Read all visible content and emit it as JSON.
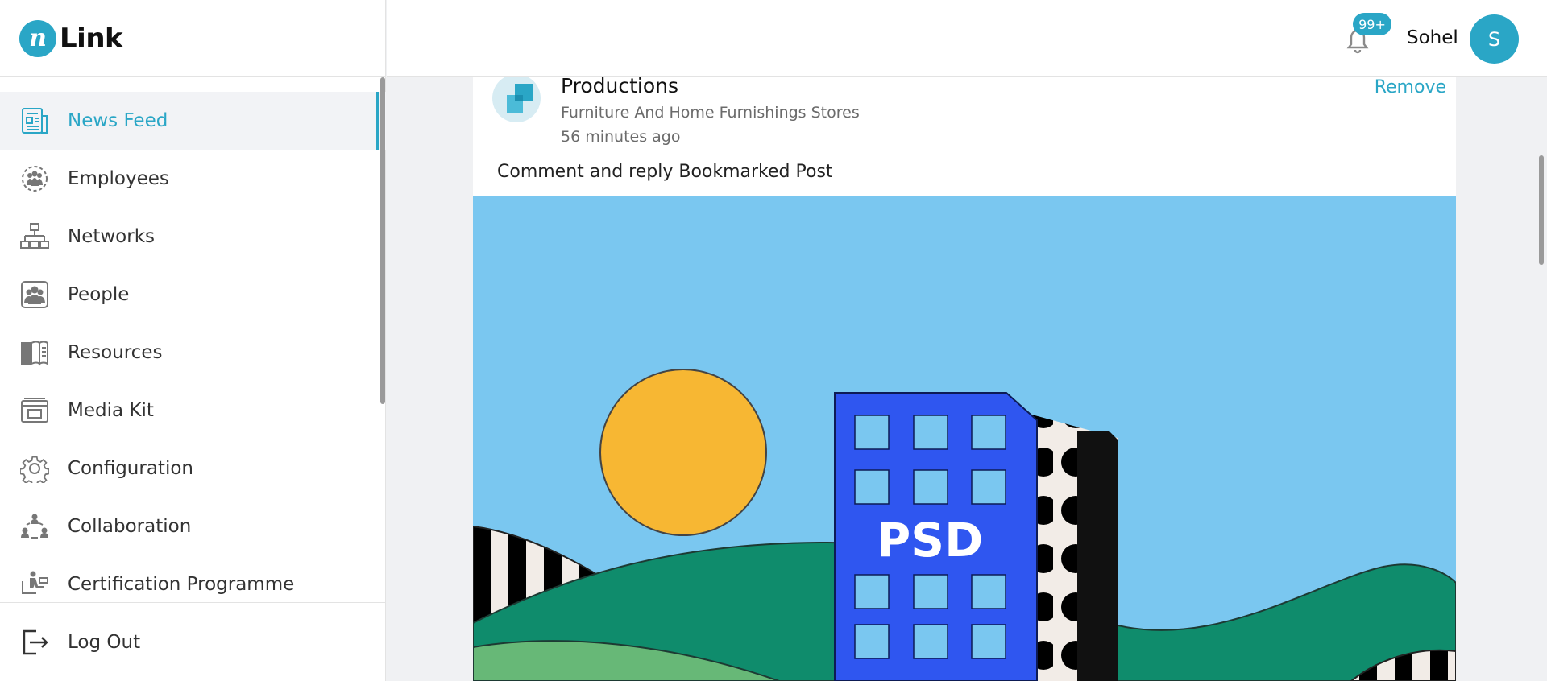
{
  "brand": {
    "mark": "n",
    "name": "Link"
  },
  "sidebar": {
    "items": [
      {
        "label": "News Feed",
        "icon": "news-feed-icon",
        "active": true
      },
      {
        "label": "Employees",
        "icon": "employees-icon"
      },
      {
        "label": "Networks",
        "icon": "network-icon"
      },
      {
        "label": "People",
        "icon": "people-icon"
      },
      {
        "label": "Resources",
        "icon": "book-icon"
      },
      {
        "label": "Media Kit",
        "icon": "media-kit-icon"
      },
      {
        "label": "Configuration",
        "icon": "gear-icon"
      },
      {
        "label": "Collaboration",
        "icon": "collaboration-icon"
      },
      {
        "label": "Certification Programme",
        "icon": "certification-icon"
      }
    ],
    "logout_label": "Log Out"
  },
  "header": {
    "notification_count": "99+",
    "user_name": "Sohel",
    "avatar_initial": "S"
  },
  "post": {
    "title": "Productions",
    "category": "Furniture And Home Furnishings Stores",
    "time": "56 minutes ago",
    "remove_label": "Remove",
    "text": "Comment and reply Bookmarked Post",
    "image_text": "PSD"
  },
  "colors": {
    "accent": "#2aa6c6",
    "sky": "#7ac7f0",
    "sun": "#f7b733",
    "building": "#2f56f0",
    "hills": "#0f8c6c"
  }
}
